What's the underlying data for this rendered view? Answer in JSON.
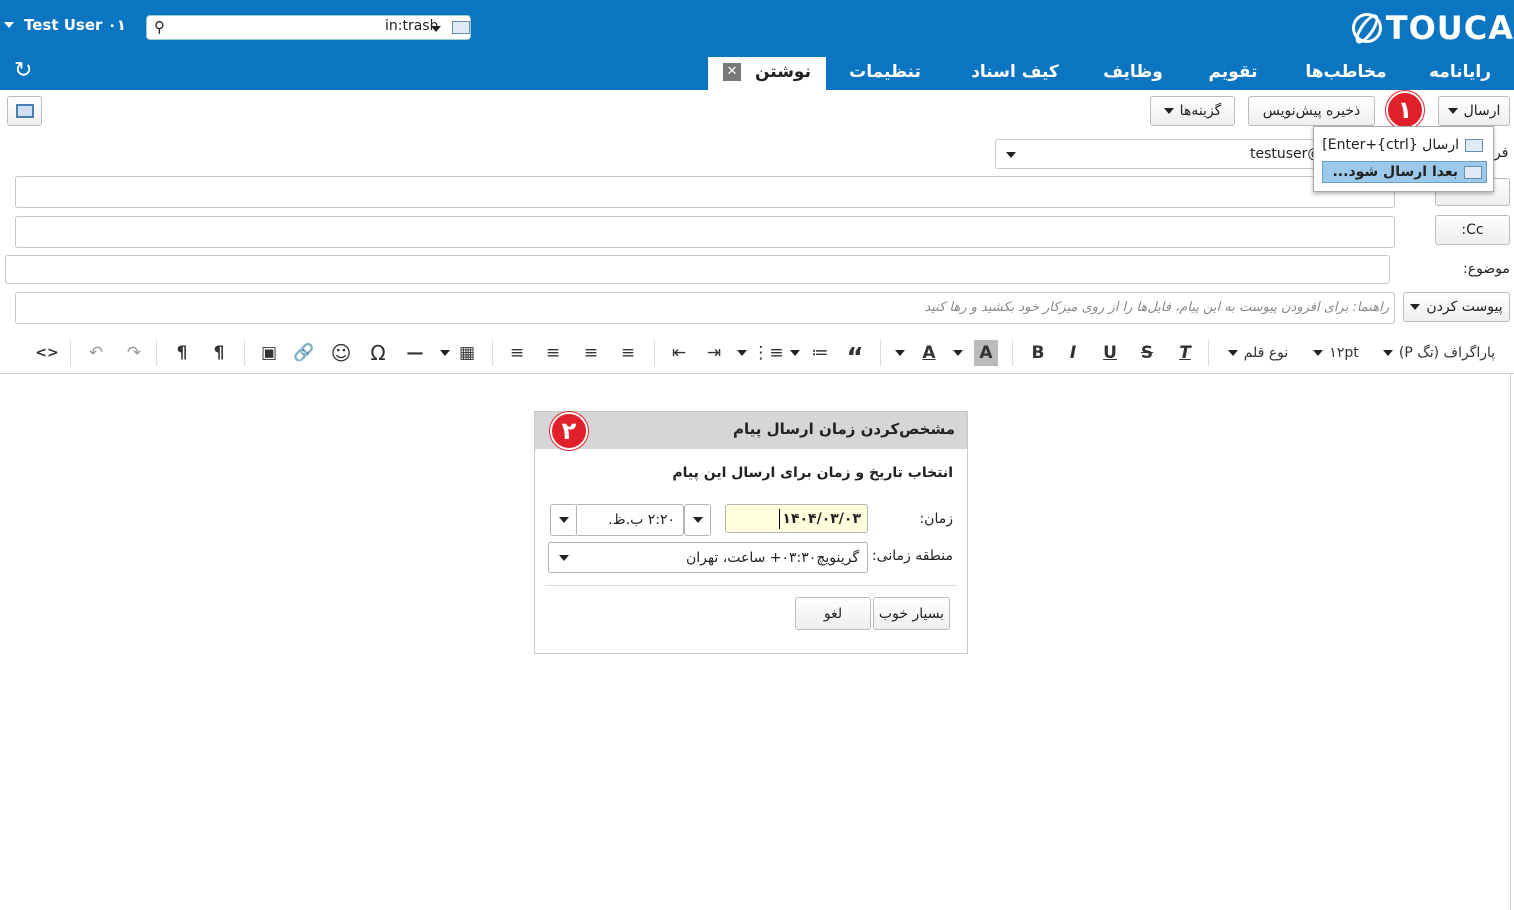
{
  "header": {
    "brand": "TOUCA",
    "user_name": "Test User ۰۱",
    "search_query": "in:trash",
    "tabs": [
      {
        "label": "رایانامه"
      },
      {
        "label": "مخاطب‌ها"
      },
      {
        "label": "تقویم"
      },
      {
        "label": "وظایف"
      },
      {
        "label": "کیف اسناد"
      },
      {
        "label": "تنظیمات"
      },
      {
        "label": "نوشتن"
      }
    ]
  },
  "compose_toolbar": {
    "send_label": "ارسال",
    "save_draft_label": "ذخیره پیش‌نویس",
    "options_label": "گزینه‌ها",
    "badge_1": "۱",
    "send_menu": {
      "send_now": "ارسال {ctrl}+Enter]",
      "send_later": "بعدا ارسال شود..."
    }
  },
  "compose_form": {
    "from_label": "فر",
    "from_value": "testuser@",
    "cc_label": ":Cc",
    "subject_label": "موضوع:",
    "attach_label": "پیوست کردن",
    "attach_hint": "راهنما: برای افزودن پیوست به این پیام، فایل‌ها را از روی میزکار خود بکشید و رها کنید"
  },
  "editor_toolbar": {
    "paragraph": "پاراگراف (تگ P)",
    "font_size": "۱۲pt",
    "font_family": "نوع قلم",
    "icons": [
      "clear-format",
      "strikethrough",
      "underline",
      "italic",
      "bold",
      "bg-color",
      "text-color",
      "blockquote",
      "numbered-list",
      "bullet-list",
      "indent",
      "outdent",
      "justify",
      "align-right",
      "align-center",
      "align-left",
      "table",
      "horizontal-rule",
      "special-char",
      "emoji",
      "link",
      "image",
      "ltr",
      "rtl",
      "redo",
      "undo",
      "source-code"
    ]
  },
  "dialog": {
    "title": "مشخص‌کردن زمان ارسال پیام",
    "badge_2": "۲",
    "subtitle": "انتخاب تاریخ و زمان برای ارسال این پیام",
    "time_label": "زمان:",
    "date_value": "۱۴۰۴/۰۳/۰۳",
    "time_value": "۲:۲۰ ب.ظ.",
    "tz_label": "منطقه زمانی:",
    "tz_value": "گرینویچ۰۳:۳۰+ ساعت، تهران",
    "ok_label": "بسیار خوب",
    "cancel_label": "لغو"
  },
  "colors": {
    "header_bg": "#0b75c2",
    "badge": "#e0202a",
    "menu_highlight": "#9cc8ea",
    "date_field": "#ffffdd"
  }
}
